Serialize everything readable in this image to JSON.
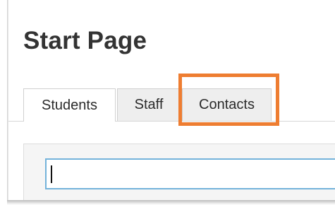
{
  "page": {
    "title": "Start Page"
  },
  "tabs": [
    {
      "label": "Students",
      "active": true
    },
    {
      "label": "Staff",
      "active": false
    },
    {
      "label": "Contacts",
      "active": false,
      "highlighted": true
    }
  ],
  "search": {
    "value": "",
    "placeholder": ""
  },
  "colors": {
    "highlight": "#ee7d31",
    "input_border": "#74b3da",
    "title_text": "#333333"
  }
}
